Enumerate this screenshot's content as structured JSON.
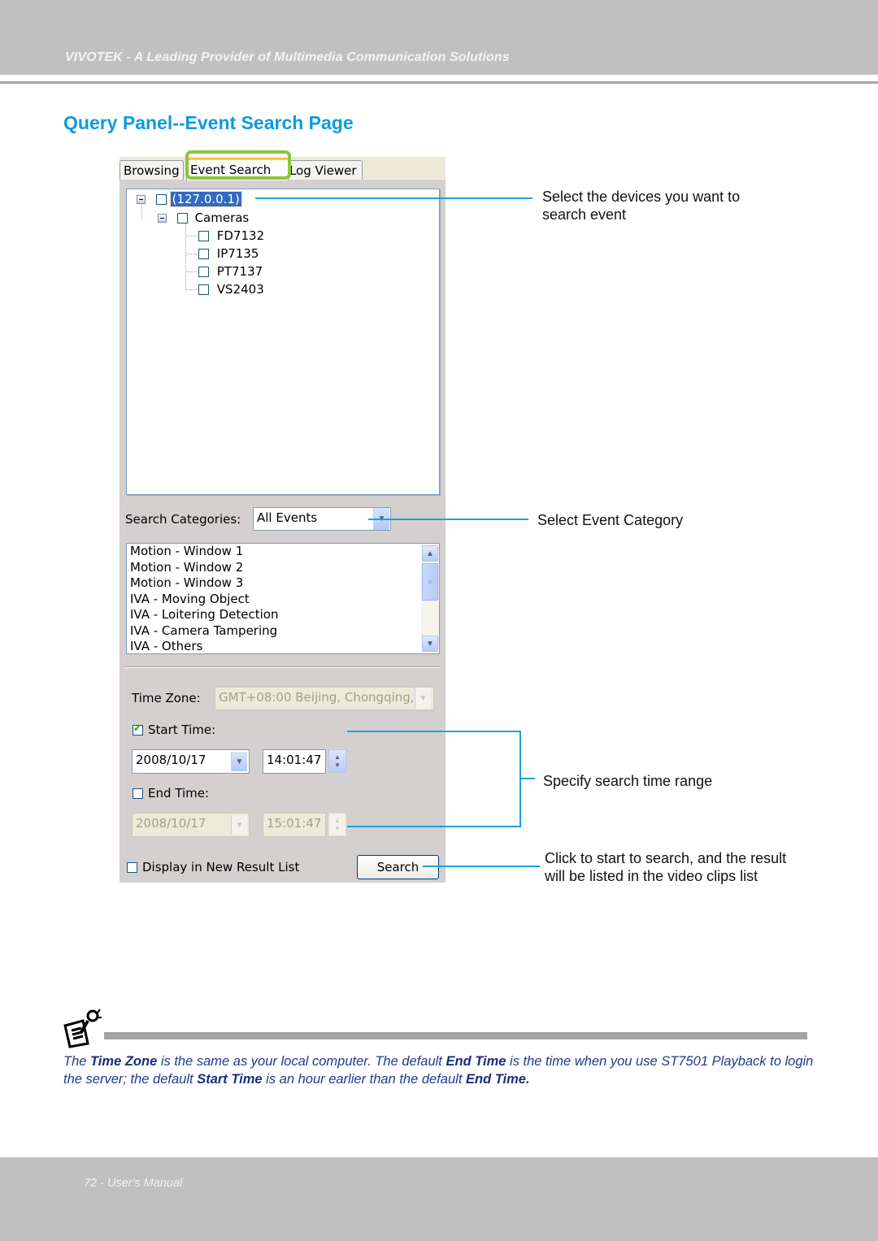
{
  "header": {
    "tagline": "VIVOTEK - A Leading Provider of Multimedia Communication Solutions"
  },
  "page_title": "Query Panel--Event Search Page",
  "panel": {
    "tabs": [
      {
        "label": "Browsing",
        "active": false
      },
      {
        "label": "Event Search",
        "active": true
      },
      {
        "label": "Log Viewer",
        "active": false
      }
    ],
    "device_tree": {
      "root": {
        "label": "(127.0.0.1)",
        "checked": false,
        "expanded": true,
        "selected": true
      },
      "group": {
        "label": "Cameras",
        "checked": false,
        "expanded": true
      },
      "cameras": [
        {
          "label": "FD7132",
          "checked": false
        },
        {
          "label": "IP7135",
          "checked": false
        },
        {
          "label": "PT7137",
          "checked": false
        },
        {
          "label": "VS2403",
          "checked": false
        }
      ]
    },
    "search_categories": {
      "label": "Search Categories:",
      "selected": "All Events"
    },
    "event_list": [
      "Motion - Window 1",
      "Motion - Window 2",
      "Motion - Window 3",
      "IVA - Moving Object",
      "IVA - Loitering Detection",
      "IVA - Camera Tampering",
      "IVA - Others"
    ],
    "time_zone": {
      "label": "Time Zone:",
      "value": "GMT+08:00 Beijing, Chongqing,"
    },
    "start_time": {
      "label": "Start Time:",
      "checked": true,
      "date": "2008/10/17",
      "time": "14:01:47"
    },
    "end_time": {
      "label": "End Time:",
      "checked": false,
      "date": "2008/10/17",
      "time": "15:01:47"
    },
    "display_new_list": {
      "label": "Display in New Result List",
      "checked": false
    },
    "search_button": "Search"
  },
  "callouts": {
    "devices_line1": "Select the devices you want to",
    "devices_line2": "search event",
    "category": "Select Event Category",
    "time_range": "Specify search time range",
    "search_line1": "Click to start to search, and the result",
    "search_line2": "will be listed in the video clips list"
  },
  "note": {
    "p1": "The ",
    "b1": "Time Zone",
    "p2": " is the same as your local computer. The default ",
    "b2": "End Time",
    "p3": " is the time when you use ST7501 Playback to login the server; the default ",
    "b3": "Start Time",
    "p4": " is an hour earlier than the default ",
    "b4": "End Time."
  },
  "footer": {
    "page_label": "72 - User's Manual"
  },
  "colors": {
    "accent_blue": "#0a9be0",
    "callout_line": "#1aa1e2",
    "tab_highlight": "#8cc63e",
    "note_text": "#1f3a8f"
  }
}
